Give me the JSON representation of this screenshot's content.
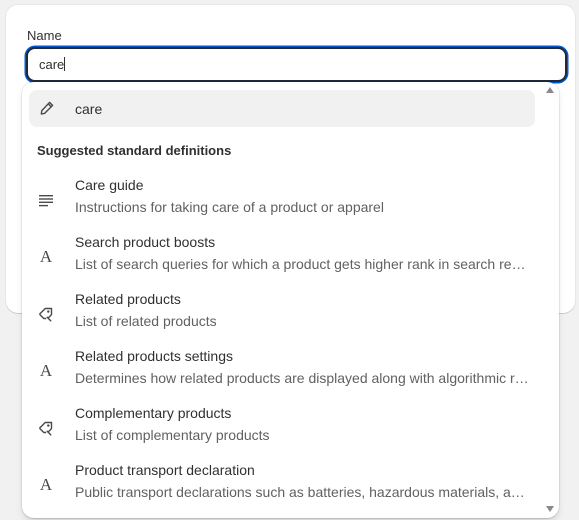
{
  "form": {
    "name_label": "Name",
    "name_value": "care"
  },
  "dropdown": {
    "custom_option": {
      "label": "care",
      "icon": "pencil-icon"
    },
    "section_heading": "Suggested standard definitions",
    "items": [
      {
        "title": "Care guide",
        "description": "Instructions for taking care of a product or apparel",
        "icon": "text-lines-icon"
      },
      {
        "title": "Search product boosts",
        "description": "List of search queries for which a product gets higher rank in search results",
        "icon": "text-type-icon"
      },
      {
        "title": "Related products",
        "description": "List of related products",
        "icon": "product-tag-icon"
      },
      {
        "title": "Related products settings",
        "description": "Determines how related products are displayed along with algorithmic recommendations",
        "icon": "text-type-icon"
      },
      {
        "title": "Complementary products",
        "description": "List of complementary products",
        "icon": "product-tag-icon"
      },
      {
        "title": "Product transport declaration",
        "description": "Public transport declarations such as batteries, hazardous materials, and other items",
        "icon": "text-type-icon"
      }
    ]
  },
  "colors": {
    "focus_ring": "#005bd3",
    "highlight_bg": "#f1f1f1",
    "text_primary": "#303030",
    "text_secondary": "#616161"
  }
}
